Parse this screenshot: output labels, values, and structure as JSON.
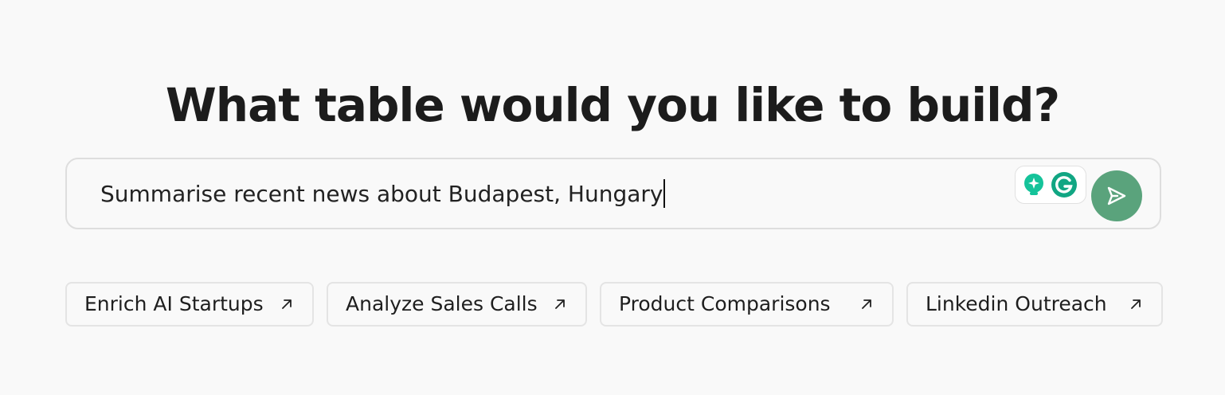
{
  "heading": "What table would you like to build?",
  "prompt": {
    "value": "Summarise recent news about Budapest, Hungary"
  },
  "extensions": [
    {
      "icon": "lightbulb-icon",
      "color": "#15c39a"
    },
    {
      "icon": "grammarly-icon",
      "color": "#11a683"
    }
  ],
  "send_button": {
    "icon": "send-icon",
    "color": "#5aa37c"
  },
  "suggestions": [
    {
      "label": "Enrich AI Startups",
      "icon": "arrow-up-right-icon"
    },
    {
      "label": "Analyze Sales Calls",
      "icon": "arrow-up-right-icon"
    },
    {
      "label": "Product Comparisons",
      "icon": "arrow-up-right-icon"
    },
    {
      "label": "Linkedin Outreach",
      "icon": "arrow-up-right-icon"
    }
  ]
}
